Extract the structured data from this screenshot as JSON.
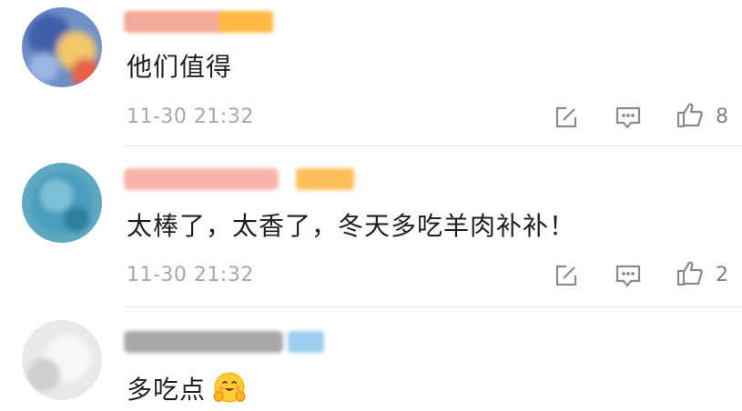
{
  "comments": [
    {
      "text": "他们值得",
      "time": "11-30 21:32",
      "likes": "8",
      "icons": [
        "edit-icon",
        "reply-icon",
        "like-icon"
      ]
    },
    {
      "text": "太棒了，太香了，冬天多吃羊肉补补！",
      "time": "11-30 21:32",
      "likes": "2",
      "icons": [
        "edit-icon",
        "reply-icon",
        "like-icon"
      ]
    },
    {
      "text": "多吃点",
      "emoji": "smiling-face-with-hands-emoji"
    }
  ],
  "colors": {
    "text": "#1f1f1f",
    "meta": "#a8a8a8",
    "icon": "#8a8a8a",
    "divider": "#e6e6e6"
  }
}
